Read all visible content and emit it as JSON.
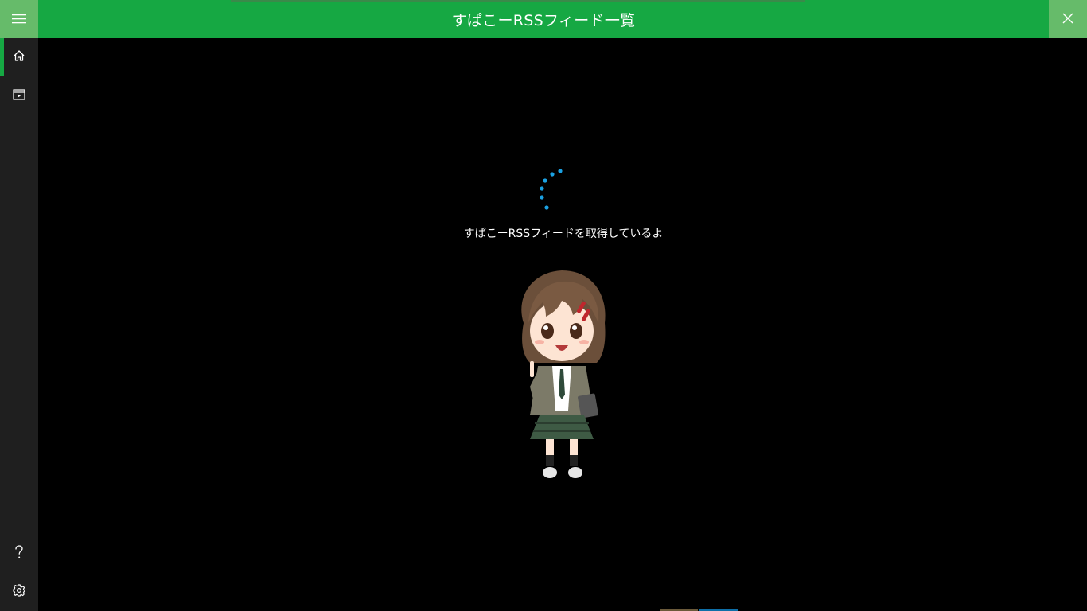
{
  "header": {
    "title": "すぱこーRSSフィード一覧"
  },
  "sidebar": {
    "items": [
      {
        "icon": "hamburger-icon"
      },
      {
        "icon": "home-icon"
      },
      {
        "icon": "video-icon"
      },
      {
        "icon": "help-icon"
      },
      {
        "icon": "gear-icon"
      }
    ]
  },
  "main": {
    "loading_text": "すぱこーRSSフィードを取得しているよ"
  },
  "colors": {
    "accent": "#16a843",
    "accent_light": "#66bb6a",
    "sidebar_bg": "#1f1f1f",
    "spinner": "#1ba1e2",
    "background": "#000000"
  }
}
